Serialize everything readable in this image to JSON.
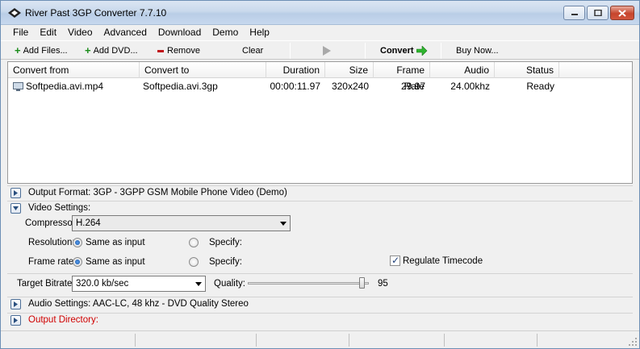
{
  "window": {
    "title": "River Past 3GP Converter 7.7.10"
  },
  "menu": [
    "File",
    "Edit",
    "Video",
    "Advanced",
    "Download",
    "Demo",
    "Help"
  ],
  "toolbar": {
    "add_files": "Add Files...",
    "add_dvd": "Add DVD...",
    "remove": "Remove",
    "clear": "Clear",
    "convert": "Convert",
    "buy_now": "Buy Now..."
  },
  "list": {
    "columns": [
      "Convert from",
      "Convert to",
      "Duration",
      "Size",
      "Frame Rate",
      "Audio",
      "Status"
    ],
    "rows": [
      {
        "from": "Softpedia.avi.mp4",
        "to": "Softpedia.avi.3gp",
        "duration": "00:00:11.97",
        "size": "320x240",
        "frame_rate": "29.97",
        "audio": "24.00khz",
        "status": "Ready"
      }
    ]
  },
  "settings": {
    "output_format": "Output Format: 3GP - 3GPP GSM Mobile Phone Video (Demo)",
    "video_settings": "Video Settings:",
    "compressor_label": "Compressor:",
    "compressor_value": "H.264",
    "resolution_label": "Resolution:",
    "frame_rate_label": "Frame rate:",
    "same_as_input": "Same as input",
    "specify": "Specify:",
    "regulate_timecode": "Regulate Timecode",
    "target_bitrate_label": "Target Bitrate:",
    "target_bitrate_value": "320.0 kb/sec",
    "quality_label": "Quality:",
    "quality_value": "95",
    "audio_settings": "Audio Settings: AAC-LC, 48 khz - DVD Quality Stereo",
    "output_directory": "Output Directory:"
  },
  "colors": {
    "output_directory_text": "#d00000",
    "add_icon": "#1a8c1a",
    "remove_icon": "#c0141a",
    "convert_arrow": "#2fb52f"
  }
}
